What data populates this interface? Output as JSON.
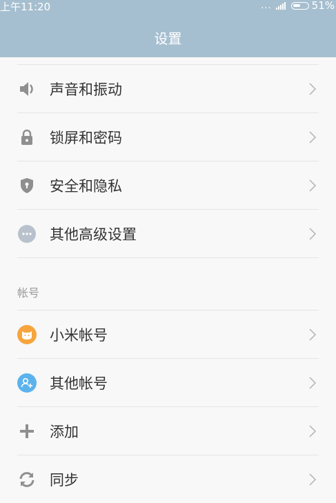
{
  "status_bar": {
    "time": "上午11:20",
    "dots": "...",
    "battery": "51%"
  },
  "header": {
    "title": "设置"
  },
  "settings_items": [
    {
      "label": "声音和振动",
      "icon": "speaker-icon"
    },
    {
      "label": "锁屏和密码",
      "icon": "lock-icon"
    },
    {
      "label": "安全和隐私",
      "icon": "shield-icon"
    },
    {
      "label": "其他高级设置",
      "icon": "more-icon"
    }
  ],
  "account_section": {
    "title": "帐号",
    "items": [
      {
        "label": "小米帐号",
        "icon": "mi-account-icon",
        "color": "#f6a53e"
      },
      {
        "label": "其他帐号",
        "icon": "person-add-icon",
        "color": "#5cb3ec"
      },
      {
        "label": "添加",
        "icon": "plus-icon"
      },
      {
        "label": "同步",
        "icon": "sync-icon"
      }
    ]
  },
  "colors": {
    "header_bg": "#a6bfd0",
    "icon_gray": "#8f8f8f",
    "text": "#333333",
    "section_text": "#9a9a9a",
    "chevron": "#b9b9b9"
  }
}
